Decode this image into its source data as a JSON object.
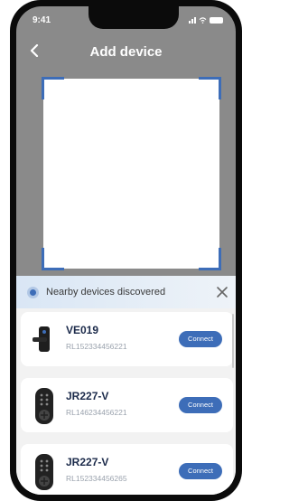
{
  "status_bar": {
    "time": "9:41"
  },
  "header": {
    "title": "Add device"
  },
  "nearby": {
    "title": "Nearby devices discovered",
    "devices": [
      {
        "name": "VE019",
        "serial": "RL152334456221",
        "button": "Connect",
        "icon": "lever-lock-icon"
      },
      {
        "name": "JR227-V",
        "serial": "RL146234456221",
        "button": "Connect",
        "icon": "keypad-lock-icon"
      },
      {
        "name": "JR227-V",
        "serial": "RL152334456265",
        "button": "Connect",
        "icon": "keypad-lock-icon"
      }
    ]
  },
  "colors": {
    "accent": "#3d6db8",
    "overlay": "#8a8a8a"
  }
}
